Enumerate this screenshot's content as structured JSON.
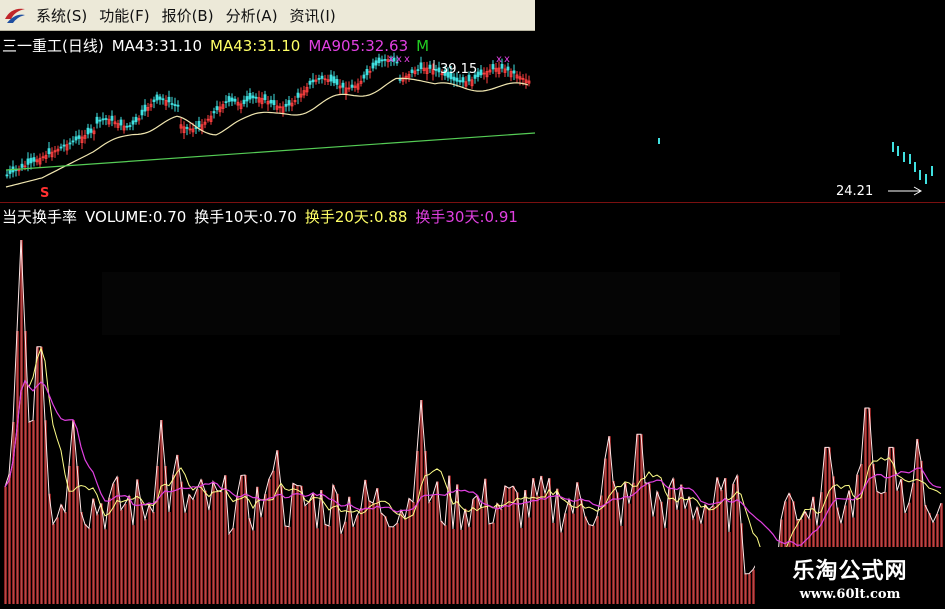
{
  "menubar": {
    "items": [
      "系统(S)",
      "功能(F)",
      "报价(B)",
      "分析(A)",
      "资讯(I)"
    ]
  },
  "main_panel": {
    "stock_title": "三一重工(日线)",
    "ma1": "MA43:31.10",
    "ma2": "MA43:31.10",
    "ma3": "MA905:32.63",
    "ma4": "M",
    "high_label": "39.15",
    "low_label": "24.21",
    "signal_marker": "S",
    "colors": {
      "ma1": "#ffffff",
      "ma2": "#ffff66",
      "ma3": "#e040e0",
      "ma4": "#22cc22"
    }
  },
  "sub_panel": {
    "title": "当天换手率",
    "volume": "VOLUME:0.70",
    "ma10": "换手10天:0.70",
    "ma20": "换手20天:0.88",
    "ma30": "换手30天:0.91",
    "colors": {
      "title": "#ffffff",
      "volume": "#ffffff",
      "ma10": "#ffffff",
      "ma20": "#ffff66",
      "ma30": "#e040e0"
    }
  },
  "watermark": {
    "title": "乐淘公式网",
    "url": "www.60lt.com"
  }
}
